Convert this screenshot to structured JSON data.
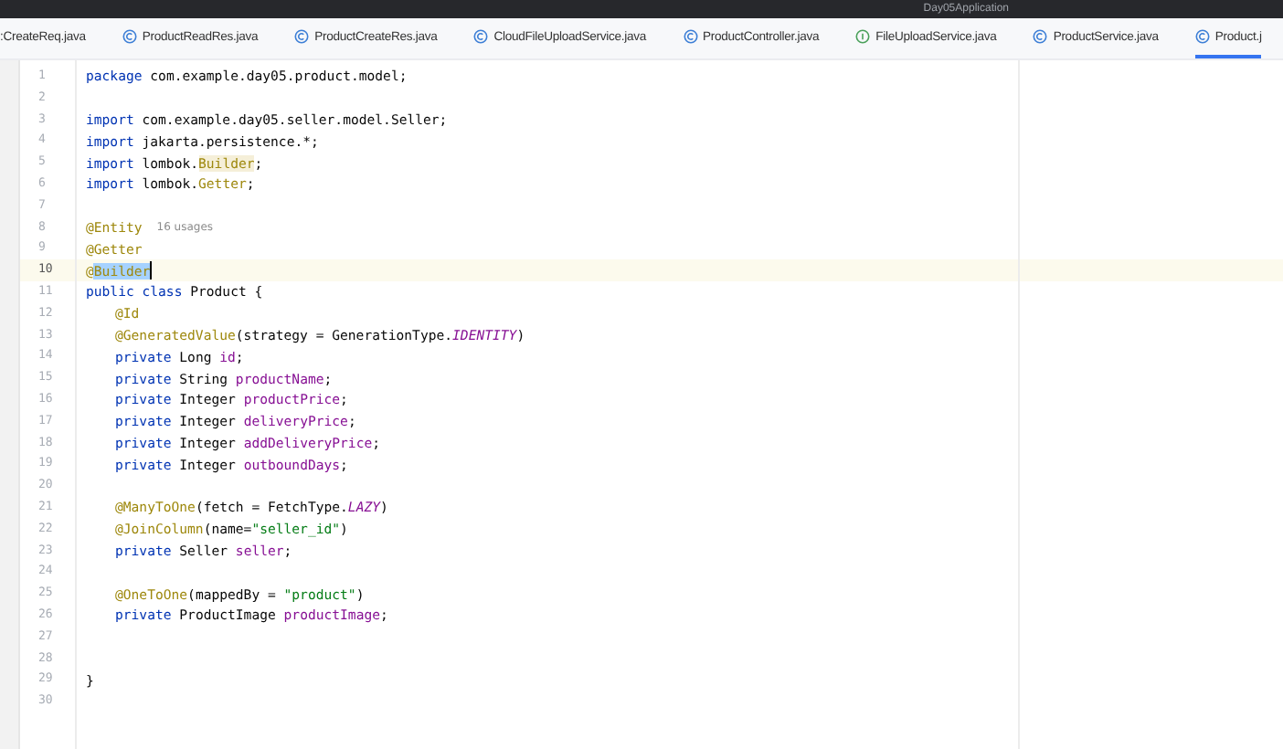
{
  "window": {
    "title": "Day05Application"
  },
  "tabs": [
    {
      "label": ":CreateReq.java",
      "kind": "none",
      "selected": false
    },
    {
      "label": "ProductReadRes.java",
      "kind": "class",
      "selected": false
    },
    {
      "label": "ProductCreateRes.java",
      "kind": "class",
      "selected": false
    },
    {
      "label": "CloudFileUploadService.java",
      "kind": "class",
      "selected": false
    },
    {
      "label": "ProductController.java",
      "kind": "class",
      "selected": false
    },
    {
      "label": "FileUploadService.java",
      "kind": "interface",
      "selected": false
    },
    {
      "label": "ProductService.java",
      "kind": "class",
      "selected": false
    },
    {
      "label": "Product.j",
      "kind": "class",
      "selected": true
    }
  ],
  "editor": {
    "lines": [
      {
        "number": "1",
        "current": false,
        "indented": false,
        "tokens": [
          {
            "text": "package",
            "kind": "keyword"
          },
          {
            "text": " com.example.day05.product.model;",
            "kind": "plain"
          }
        ]
      },
      {
        "number": "2",
        "current": false
      },
      {
        "number": "3",
        "current": false,
        "indented": false,
        "tokens": [
          {
            "text": "import",
            "kind": "keyword"
          },
          {
            "text": " com.example.day05.seller.model.Seller;",
            "kind": "plain"
          }
        ]
      },
      {
        "number": "4",
        "current": false,
        "indented": false,
        "tokens": [
          {
            "text": "import",
            "kind": "keyword"
          },
          {
            "text": " jakarta.persistence.*;",
            "kind": "plain"
          }
        ]
      },
      {
        "number": "5",
        "current": false,
        "indented": false,
        "tokens": [
          {
            "text": "import",
            "kind": "keyword"
          },
          {
            "text": " lombok.",
            "kind": "plain"
          },
          {
            "text": "Builder",
            "kind": "highlighted"
          },
          {
            "text": ";",
            "kind": "plain"
          }
        ]
      },
      {
        "number": "6",
        "current": false,
        "indented": false,
        "tokens": [
          {
            "text": "import",
            "kind": "keyword"
          },
          {
            "text": " lombok.",
            "kind": "plain"
          },
          {
            "text": "Getter",
            "kind": "annotation"
          },
          {
            "text": ";",
            "kind": "plain"
          }
        ]
      },
      {
        "number": "7",
        "current": false
      },
      {
        "number": "8",
        "current": false,
        "indented": false,
        "tokens": [
          {
            "text": "@Entity",
            "kind": "annotation"
          },
          {
            "text": "16 usages",
            "kind": "hint"
          }
        ]
      },
      {
        "number": "9",
        "current": false,
        "indented": false,
        "tokens": [
          {
            "text": "@Getter",
            "kind": "annotation"
          }
        ]
      },
      {
        "number": "10",
        "current": true,
        "indented": false,
        "tokens": [
          {
            "text": "@",
            "kind": "annotation"
          },
          {
            "text": "Builder",
            "kind": "selection"
          }
        ]
      },
      {
        "number": "11",
        "current": false,
        "indented": false,
        "tokens": [
          {
            "text": "public class",
            "kind": "keyword"
          },
          {
            "text": " Product {",
            "kind": "plain"
          }
        ]
      },
      {
        "number": "12",
        "current": false,
        "indented": true,
        "tokens": [
          {
            "text": "@Id",
            "kind": "annotation"
          }
        ]
      },
      {
        "number": "13",
        "current": false,
        "indented": true,
        "tokens": [
          {
            "text": "@GeneratedValue",
            "kind": "annotation"
          },
          {
            "text": "(strategy = GenerationType.",
            "kind": "plain"
          },
          {
            "text": "IDENTITY",
            "kind": "constant"
          },
          {
            "text": ")",
            "kind": "plain"
          }
        ]
      },
      {
        "number": "14",
        "current": false,
        "indented": true,
        "tokens": [
          {
            "text": "private",
            "kind": "keyword"
          },
          {
            "text": " Long ",
            "kind": "plain"
          },
          {
            "text": "id",
            "kind": "field"
          },
          {
            "text": ";",
            "kind": "plain"
          }
        ]
      },
      {
        "number": "15",
        "current": false,
        "indented": true,
        "tokens": [
          {
            "text": "private",
            "kind": "keyword"
          },
          {
            "text": " String ",
            "kind": "plain"
          },
          {
            "text": "productName",
            "kind": "field"
          },
          {
            "text": ";",
            "kind": "plain"
          }
        ]
      },
      {
        "number": "16",
        "current": false,
        "indented": true,
        "tokens": [
          {
            "text": "private",
            "kind": "keyword"
          },
          {
            "text": " Integer ",
            "kind": "plain"
          },
          {
            "text": "productPrice",
            "kind": "field"
          },
          {
            "text": ";",
            "kind": "plain"
          }
        ]
      },
      {
        "number": "17",
        "current": false,
        "indented": true,
        "tokens": [
          {
            "text": "private",
            "kind": "keyword"
          },
          {
            "text": " Integer ",
            "kind": "plain"
          },
          {
            "text": "deliveryPrice",
            "kind": "field"
          },
          {
            "text": ";",
            "kind": "plain"
          }
        ]
      },
      {
        "number": "18",
        "current": false,
        "indented": true,
        "tokens": [
          {
            "text": "private",
            "kind": "keyword"
          },
          {
            "text": " Integer ",
            "kind": "plain"
          },
          {
            "text": "addDeliveryPrice",
            "kind": "field"
          },
          {
            "text": ";",
            "kind": "plain"
          }
        ]
      },
      {
        "number": "19",
        "current": false,
        "indented": true,
        "tokens": [
          {
            "text": "private",
            "kind": "keyword"
          },
          {
            "text": " Integer ",
            "kind": "plain"
          },
          {
            "text": "outboundDays",
            "kind": "field"
          },
          {
            "text": ";",
            "kind": "plain"
          }
        ]
      },
      {
        "number": "20",
        "current": false
      },
      {
        "number": "21",
        "current": false,
        "indented": true,
        "tokens": [
          {
            "text": "@ManyToOne",
            "kind": "annotation"
          },
          {
            "text": "(fetch = FetchType.",
            "kind": "plain"
          },
          {
            "text": "LAZY",
            "kind": "constant"
          },
          {
            "text": ")",
            "kind": "plain"
          }
        ]
      },
      {
        "number": "22",
        "current": false,
        "indented": true,
        "tokens": [
          {
            "text": "@JoinColumn",
            "kind": "annotation"
          },
          {
            "text": "(name=",
            "kind": "plain"
          },
          {
            "text": "\"seller_id\"",
            "kind": "string"
          },
          {
            "text": ")",
            "kind": "plain"
          }
        ]
      },
      {
        "number": "23",
        "current": false,
        "indented": true,
        "tokens": [
          {
            "text": "private",
            "kind": "keyword"
          },
          {
            "text": " Seller ",
            "kind": "plain"
          },
          {
            "text": "seller",
            "kind": "field"
          },
          {
            "text": ";",
            "kind": "plain"
          }
        ]
      },
      {
        "number": "24",
        "current": false
      },
      {
        "number": "25",
        "current": false,
        "indented": true,
        "tokens": [
          {
            "text": "@OneToOne",
            "kind": "annotation"
          },
          {
            "text": "(mappedBy = ",
            "kind": "plain"
          },
          {
            "text": "\"product\"",
            "kind": "string"
          },
          {
            "text": ")",
            "kind": "plain"
          }
        ]
      },
      {
        "number": "26",
        "current": false,
        "indented": true,
        "tokens": [
          {
            "text": "private",
            "kind": "keyword"
          },
          {
            "text": " ProductImage ",
            "kind": "plain"
          },
          {
            "text": "productImage",
            "kind": "field"
          },
          {
            "text": ";",
            "kind": "plain"
          }
        ]
      },
      {
        "number": "27",
        "current": false
      },
      {
        "number": "28",
        "current": false
      },
      {
        "number": "29",
        "current": false,
        "indented": false,
        "tokens": [
          {
            "text": "}",
            "kind": "plain"
          }
        ]
      },
      {
        "number": "30",
        "current": false
      }
    ]
  }
}
